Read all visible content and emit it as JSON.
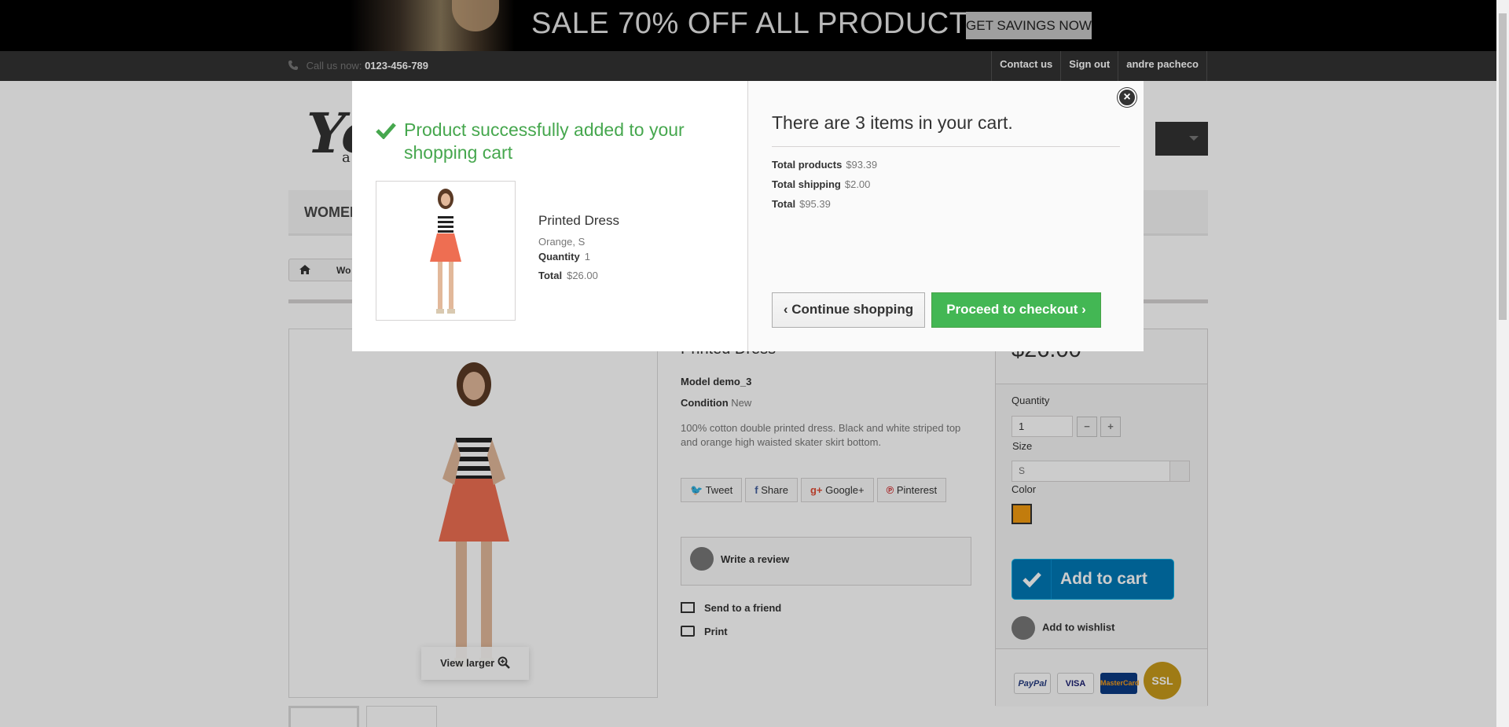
{
  "banner": {
    "headline": "SALE 70% OFF ALL PRODUCTS",
    "cta": "GET SAVINGS NOW"
  },
  "topnav": {
    "call_label": "Call us now:",
    "phone": "0123-456-789",
    "links": [
      "Contact us",
      "Sign out",
      "andre pacheco"
    ]
  },
  "header": {
    "logo_text": "Yo",
    "logo_tag": "a",
    "menu_first": "WOMEN",
    "breadcrumb": "Wo"
  },
  "product": {
    "name": "Printed Dress",
    "model_label": "Model",
    "model": "demo_3",
    "condition_label": "Condition",
    "condition": "New",
    "description": "100% cotton double printed dress. Black and white striped top and orange high waisted skater skirt bottom.",
    "view_larger": "View larger",
    "social": [
      "Tweet",
      "Share",
      "Google+",
      "Pinterest"
    ],
    "write_review": "Write a review",
    "send_friend": "Send to a friend",
    "print": "Print"
  },
  "buybox": {
    "price": "$26.00",
    "quantity_label": "Quantity",
    "quantity": "1",
    "minus": "−",
    "plus": "+",
    "size_label": "Size",
    "size": "S",
    "color_label": "Color",
    "color_hex": "#f39c11",
    "add_to_cart": "Add to cart",
    "add_to_wishlist": "Add to wishlist",
    "payments": [
      "PayPal",
      "VISA",
      "MasterCard",
      "SSL"
    ]
  },
  "modal": {
    "success_message": "Product successfully added to your shopping cart",
    "product_name": "Printed Dress",
    "attributes": "Orange, S",
    "quantity_label": "Quantity",
    "quantity": "1",
    "total_label": "Total",
    "total": "$26.00",
    "cart_summary": "There are 3 items in your cart.",
    "total_products_label": "Total products",
    "total_products": "$93.39",
    "total_shipping_label": "Total shipping",
    "total_shipping": "$2.00",
    "total_cart_label": "Total",
    "total_cart": "$95.39",
    "continue_label": "Continue shopping",
    "checkout_label": "Proceed to checkout",
    "close": "×"
  },
  "colors": {
    "success": "#46a74e",
    "checkout": "#43b754",
    "add_to_cart": "#0079b6"
  }
}
